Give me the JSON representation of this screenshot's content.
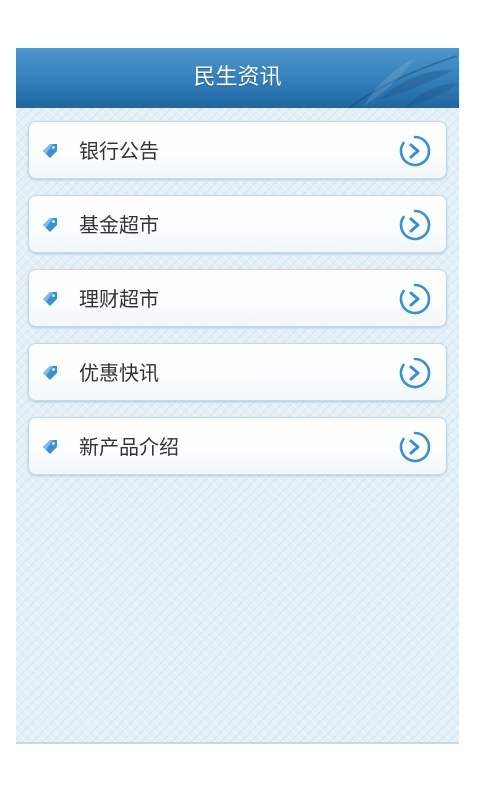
{
  "header": {
    "title": "民生资讯"
  },
  "menu": {
    "items": [
      {
        "label": "银行公告",
        "icon": "tag-icon",
        "action_icon": "chevron-right-circle-icon"
      },
      {
        "label": "基金超市",
        "icon": "tag-icon",
        "action_icon": "chevron-right-circle-icon"
      },
      {
        "label": "理财超市",
        "icon": "tag-icon",
        "action_icon": "chevron-right-circle-icon"
      },
      {
        "label": "优惠快讯",
        "icon": "tag-icon",
        "action_icon": "chevron-right-circle-icon"
      },
      {
        "label": "新产品介绍",
        "icon": "tag-icon",
        "action_icon": "chevron-right-circle-icon"
      }
    ]
  },
  "colors": {
    "header_top": "#4f97cc",
    "header_bottom": "#1f66a3",
    "background": "#e3f0f7",
    "item_border": "#c6d9e6",
    "icon_blue": "#3a8fd0",
    "text": "#333333"
  }
}
